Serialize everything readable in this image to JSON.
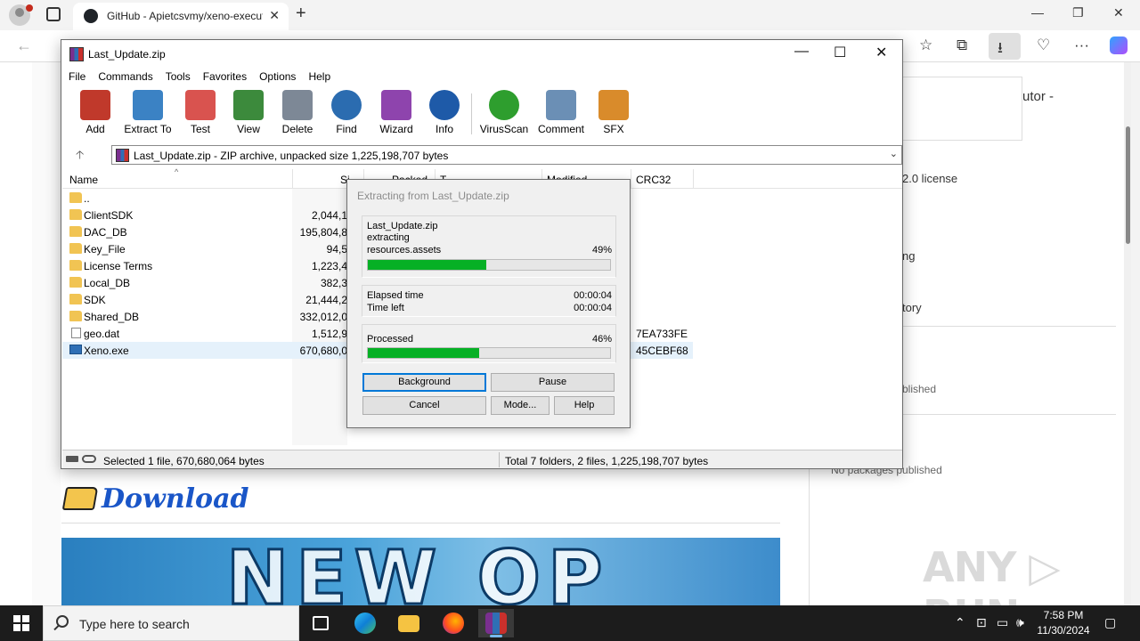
{
  "browser": {
    "tab_title": "GitHub - Apietcsvmy/xeno-executor",
    "tab_close": "✕",
    "new_tab": "+",
    "win_minimize": "—",
    "win_restore": "❐",
    "win_close": "✕",
    "back": "←",
    "tools": [
      "☆",
      "⧉",
      "⭳",
      "♡",
      "···"
    ]
  },
  "page": {
    "sidebar_title_fragment": "utor -",
    "license_fragment": "2.0 license",
    "ng_fragment": "ng",
    "tory_fragment": "tory",
    "published_fragment": "blished",
    "no_packages": "No packages published",
    "download_heading": "Download",
    "banner_text": "NEW OP",
    "watermark": "ANY ▷ RUN"
  },
  "winrar": {
    "title": "Last_Update.zip",
    "controls": {
      "minimize": "—",
      "maximize": "☐",
      "close": "✕"
    },
    "menu": [
      "File",
      "Commands",
      "Tools",
      "Favorites",
      "Options",
      "Help"
    ],
    "toolbar": [
      {
        "label": "Add",
        "icon": "add-icon",
        "color": "#c0392b"
      },
      {
        "label": "Extract To",
        "icon": "extract-to-icon",
        "color": "#3b82c4"
      },
      {
        "label": "Test",
        "icon": "test-icon",
        "color": "#d9534f"
      },
      {
        "label": "View",
        "icon": "view-icon",
        "color": "#3c8a3c"
      },
      {
        "label": "Delete",
        "icon": "delete-icon",
        "color": "#7d8896"
      },
      {
        "label": "Find",
        "icon": "find-icon",
        "color": "#2b6cb0"
      },
      {
        "label": "Wizard",
        "icon": "wizard-icon",
        "color": "#8e44ad"
      },
      {
        "label": "Info",
        "icon": "info-icon",
        "color": "#1e5aa8"
      },
      {
        "label": "VirusScan",
        "icon": "virusscan-icon",
        "color": "#2e9e2e"
      },
      {
        "label": "Comment",
        "icon": "comment-icon",
        "color": "#6b8fb5"
      },
      {
        "label": "SFX",
        "icon": "sfx-icon",
        "color": "#d98b2b"
      }
    ],
    "path": "Last_Update.zip - ZIP archive, unpacked size 1,225,198,707 bytes",
    "columns": {
      "name": "Name",
      "size": "Si",
      "packed": "Packed",
      "type": "T",
      "modified": "Modified",
      "crc": "CRC32"
    },
    "rows": [
      {
        "name": "..",
        "size": "",
        "crc": "",
        "kind": "folder"
      },
      {
        "name": "ClientSDK",
        "size": "2,044,1",
        "crc": "",
        "kind": "folder"
      },
      {
        "name": "DAC_DB",
        "size": "195,804,8",
        "crc": "",
        "kind": "folder"
      },
      {
        "name": "Key_File",
        "size": "94,5",
        "crc": "",
        "kind": "folder"
      },
      {
        "name": "License Terms",
        "size": "1,223,4",
        "crc": "",
        "kind": "folder"
      },
      {
        "name": "Local_DB",
        "size": "382,3",
        "crc": "",
        "kind": "folder"
      },
      {
        "name": "SDK",
        "size": "21,444,2",
        "crc": "",
        "kind": "folder"
      },
      {
        "name": "Shared_DB",
        "size": "332,012,0",
        "crc": "",
        "kind": "folder"
      },
      {
        "name": "geo.dat",
        "size": "1,512,9",
        "crc": "7EA733FE",
        "kind": "file"
      },
      {
        "name": "Xeno.exe",
        "size": "670,680,0",
        "crc": "45CEBF68",
        "kind": "exe"
      }
    ],
    "status_left": "Selected 1 file, 670,680,064 bytes",
    "status_right": "Total 7 folders, 2 files, 1,225,198,707 bytes"
  },
  "dialog": {
    "title": "Extracting from Last_Update.zip",
    "archive": "Last_Update.zip",
    "action": "extracting",
    "current_file": "resources.assets",
    "file_percent_label": "49%",
    "file_progress": 0.49,
    "elapsed_label": "Elapsed time",
    "elapsed_value": "00:00:04",
    "left_label": "Time left",
    "left_value": "00:00:04",
    "processed_label": "Processed",
    "processed_percent_label": "46%",
    "processed_progress": 0.46,
    "buttons": {
      "background": "Background",
      "pause": "Pause",
      "cancel": "Cancel",
      "mode": "Mode...",
      "help": "Help"
    }
  },
  "taskbar": {
    "search_placeholder": "Type here to search",
    "time": "7:58 PM",
    "date": "11/30/2024",
    "tray": [
      "⌃",
      "⊡",
      "▭",
      "🕪",
      "▢"
    ]
  }
}
